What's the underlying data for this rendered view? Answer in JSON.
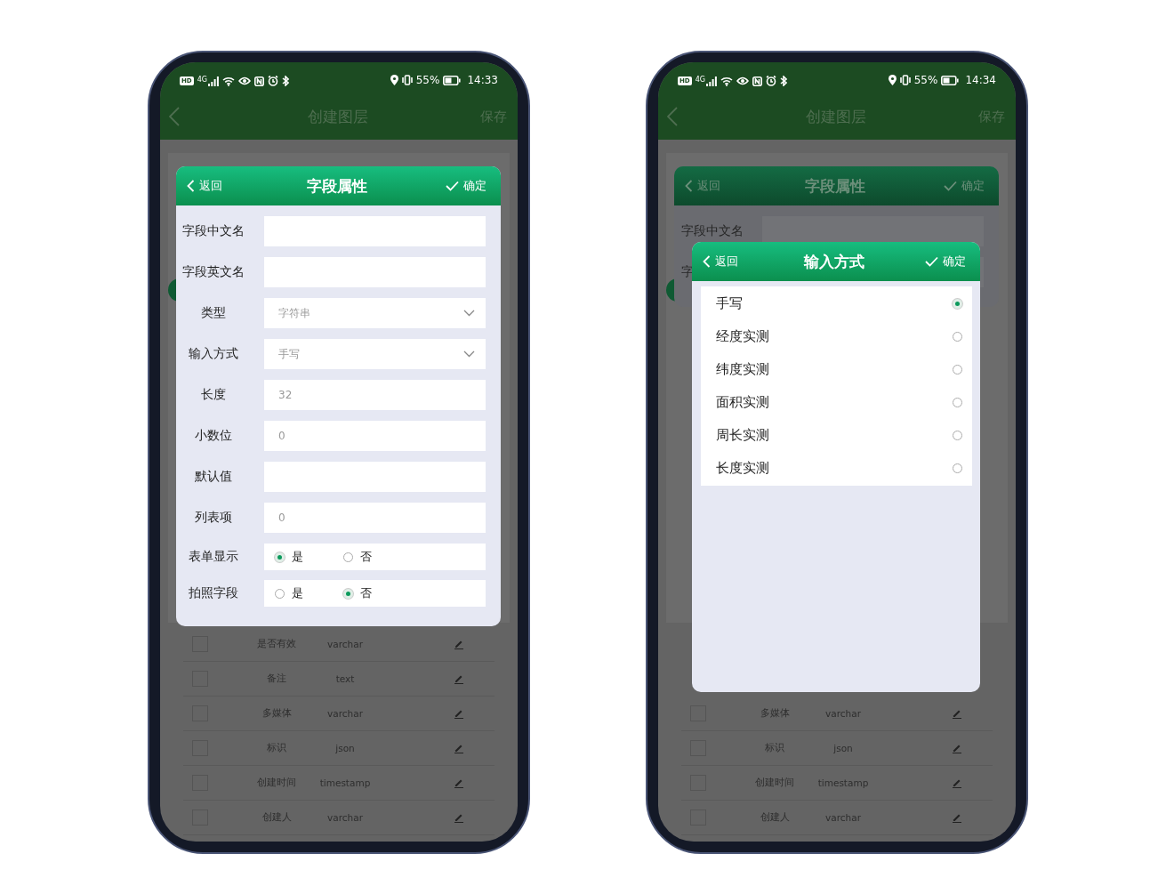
{
  "phones": [
    {
      "status_bar": {
        "hd": "HD",
        "network": "4G",
        "battery": "55%",
        "time": "14:33"
      },
      "app_bar": {
        "title": "创建图层",
        "action": "保存"
      },
      "field_rows": [
        {
          "name": "是否有效",
          "type": "varchar",
          "checked": false
        },
        {
          "name": "备注",
          "type": "text",
          "checked": false
        },
        {
          "name": "多媒体",
          "type": "varchar",
          "checked": false
        },
        {
          "name": "标识",
          "type": "json",
          "checked": false
        },
        {
          "name": "创建时间",
          "type": "timestamp",
          "checked": false
        },
        {
          "name": "创建人",
          "type": "varchar",
          "checked": false
        }
      ],
      "dialogs": [
        {
          "kind": "form",
          "dimmed": false,
          "back": "返回",
          "title": "字段属性",
          "confirm": "确定",
          "fields": [
            {
              "label": "字段中文名",
              "kind": "text"
            },
            {
              "label": "字段英文名",
              "kind": "text"
            },
            {
              "label": "类型",
              "kind": "select",
              "value": "字符串"
            },
            {
              "label": "输入方式",
              "kind": "select",
              "value": "手写"
            },
            {
              "label": "长度",
              "kind": "text",
              "value": "32"
            },
            {
              "label": "小数位",
              "kind": "text",
              "value": "0"
            },
            {
              "label": "默认值",
              "kind": "text"
            },
            {
              "label": "列表项",
              "kind": "text",
              "value": "0"
            },
            {
              "label": "表单显示",
              "kind": "radio",
              "options": [
                {
                  "label": "是",
                  "selected": true
                },
                {
                  "label": "否",
                  "selected": false
                }
              ]
            },
            {
              "label": "拍照字段",
              "kind": "radio",
              "options": [
                {
                  "label": "是",
                  "selected": false
                },
                {
                  "label": "否",
                  "selected": true
                }
              ]
            }
          ]
        }
      ]
    },
    {
      "status_bar": {
        "hd": "HD",
        "network": "4G",
        "battery": "55%",
        "time": "14:34"
      },
      "app_bar": {
        "title": "创建图层",
        "action": "保存"
      },
      "field_rows": [
        {
          "name": "多媒体",
          "type": "varchar",
          "checked": false
        },
        {
          "name": "标识",
          "type": "json",
          "checked": false
        },
        {
          "name": "创建时间",
          "type": "timestamp",
          "checked": false
        },
        {
          "name": "创建人",
          "type": "varchar",
          "checked": false
        }
      ],
      "dialogs": [
        {
          "kind": "form",
          "dimmed": true,
          "back": "返回",
          "title": "字段属性",
          "confirm": "确定",
          "fields": [
            {
              "label": "字段中文名",
              "kind": "text"
            },
            {
              "label": "字",
              "kind": "text"
            }
          ]
        },
        {
          "kind": "options",
          "dimmed": false,
          "back": "返回",
          "title": "输入方式",
          "confirm": "确定",
          "options": [
            {
              "label": "手写",
              "selected": true
            },
            {
              "label": "经度实测",
              "selected": false
            },
            {
              "label": "纬度实测",
              "selected": false
            },
            {
              "label": "面积实测",
              "selected": false
            },
            {
              "label": "周长实测",
              "selected": false
            },
            {
              "label": "长度实测",
              "selected": false
            }
          ]
        }
      ]
    }
  ]
}
